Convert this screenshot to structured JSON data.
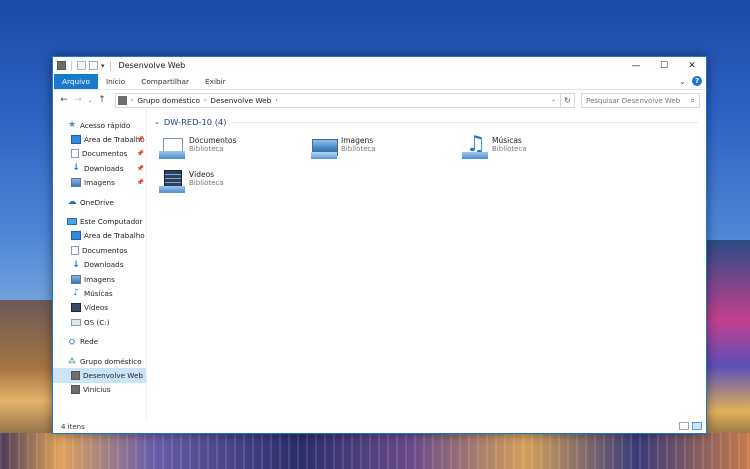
{
  "window": {
    "title": "Desenvolve Web",
    "controls": {
      "minimize": "—",
      "maximize": "☐",
      "close": "✕"
    }
  },
  "ribbon": {
    "tabs": [
      {
        "label": "Arquivo",
        "active": true
      },
      {
        "label": "Início"
      },
      {
        "label": "Compartilhar"
      },
      {
        "label": "Exibir"
      }
    ],
    "help": "?"
  },
  "navigation": {
    "back": "←",
    "forward": "→",
    "recent": "⌄",
    "up": "↑",
    "breadcrumb": [
      "Grupo doméstico",
      "Desenvolve Web"
    ],
    "refresh": "↻",
    "search_placeholder": "Pesquisar Desenvolve Web"
  },
  "sidebar": {
    "quick_access": {
      "label": "Acesso rápido",
      "items": [
        {
          "label": "Área de Trabalho",
          "icon": "desktop-icon",
          "pinned": true
        },
        {
          "label": "Documentos",
          "icon": "documents-icon",
          "pinned": true
        },
        {
          "label": "Downloads",
          "icon": "downloads-icon",
          "pinned": true
        },
        {
          "label": "Imagens",
          "icon": "pictures-icon",
          "pinned": true
        }
      ]
    },
    "onedrive": {
      "label": "OneDrive"
    },
    "this_pc": {
      "label": "Este Computador",
      "items": [
        {
          "label": "Área de Trabalho",
          "icon": "desktop-icon"
        },
        {
          "label": "Documentos",
          "icon": "documents-icon"
        },
        {
          "label": "Downloads",
          "icon": "downloads-icon"
        },
        {
          "label": "Imagens",
          "icon": "pictures-icon"
        },
        {
          "label": "Músicas",
          "icon": "music-icon"
        },
        {
          "label": "Vídeos",
          "icon": "videos-icon"
        },
        {
          "label": "OS (C:)",
          "icon": "drive-icon"
        }
      ]
    },
    "network": {
      "label": "Rede"
    },
    "homegroup": {
      "label": "Grupo doméstico",
      "items": [
        {
          "label": "Desenvolve Web",
          "selected": true
        },
        {
          "label": "Vinicius"
        }
      ]
    }
  },
  "content": {
    "group_header": "DW-RED-10 (4)",
    "libraries": [
      {
        "name": "Documentos",
        "type": "Biblioteca",
        "icon": "documents-library-icon"
      },
      {
        "name": "Imagens",
        "type": "Biblioteca",
        "icon": "pictures-library-icon"
      },
      {
        "name": "Músicas",
        "type": "Biblioteca",
        "icon": "music-library-icon"
      },
      {
        "name": "Vídeos",
        "type": "Biblioteca",
        "icon": "videos-library-icon"
      }
    ]
  },
  "status": {
    "item_count": "4 itens"
  },
  "colors": {
    "accent": "#1979ca",
    "selection": "#cce4f7",
    "group_header": "#1e3f8a"
  }
}
